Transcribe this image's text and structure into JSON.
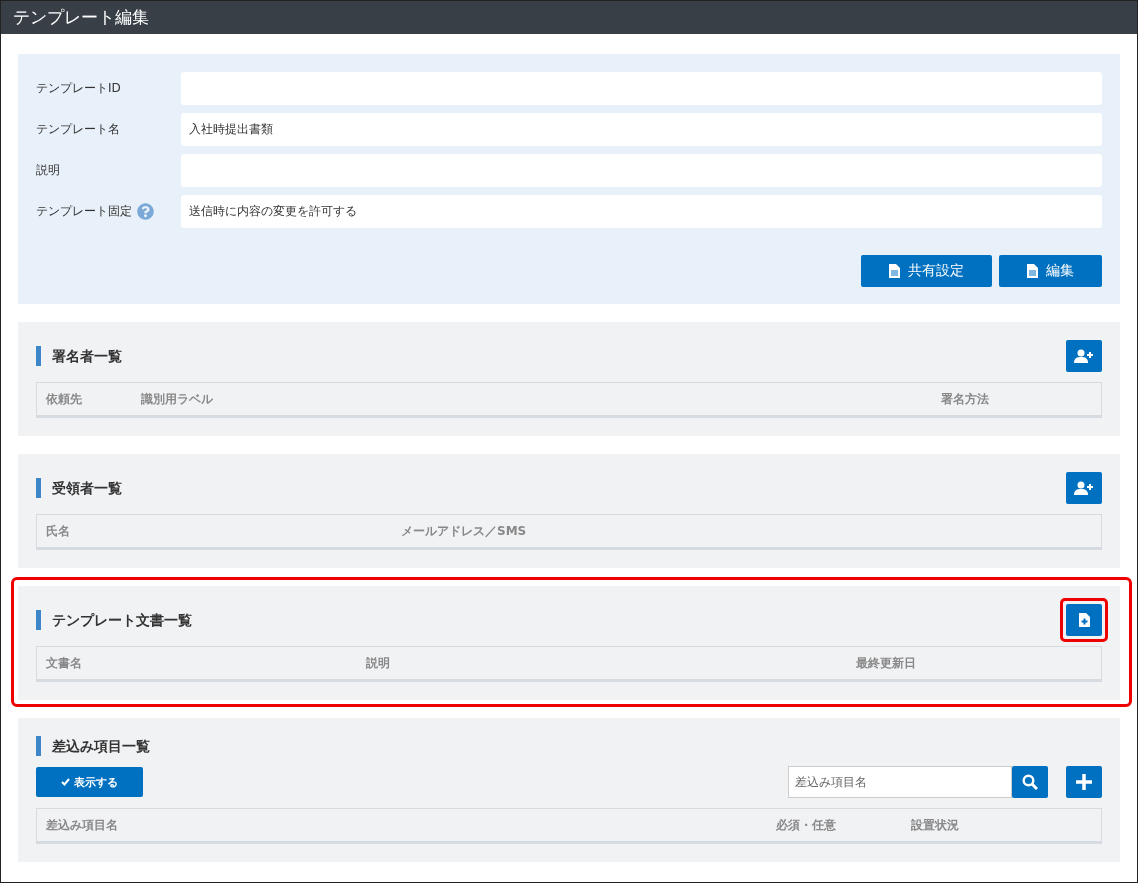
{
  "window": {
    "title": "テンプレート編集"
  },
  "form": {
    "fields": [
      {
        "label": "テンプレートID",
        "help": false
      },
      {
        "label": "テンプレート名",
        "value": "入社時提出書類",
        "help": false
      },
      {
        "label": "説明",
        "help": false
      },
      {
        "label": "テンプレート固定",
        "value": "送信時に内容の変更を許可する",
        "help": true
      }
    ],
    "buttons": [
      "共有設定",
      "編集"
    ]
  },
  "sections": [
    {
      "title": "署名者一覧",
      "kind": "person",
      "highlighted": false,
      "columns": [
        "依頼先",
        "識別用ラベル",
        "署名方法"
      ]
    },
    {
      "title": "受領者一覧",
      "kind": "person",
      "highlighted": false,
      "columns": [
        "氏名",
        "メールアドレス／SMS"
      ]
    },
    {
      "title": "テンプレート文書一覧",
      "kind": "document",
      "highlighted": true,
      "columns": [
        "文書名",
        "説明",
        "最終更新日"
      ]
    },
    {
      "title": "差込み項目一覧",
      "kind": "fields",
      "highlighted": false,
      "toggle": "表示する",
      "search_placeholder": "差込み項目名",
      "columns": [
        "差込み項目名",
        "必須・任意",
        "設置状況"
      ]
    }
  ]
}
